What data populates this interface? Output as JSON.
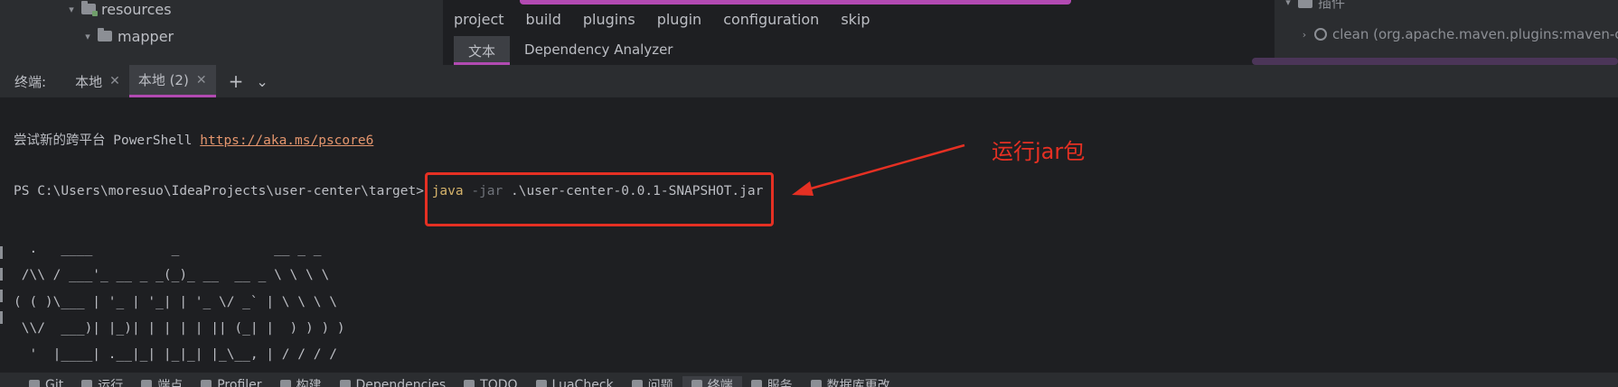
{
  "project_tree": {
    "items": [
      {
        "label": "resources",
        "expanded": true
      },
      {
        "label": "mapper",
        "expanded": true
      }
    ]
  },
  "editor": {
    "breadcrumbs": [
      "project",
      "build",
      "plugins",
      "plugin",
      "configuration",
      "skip"
    ],
    "tabs": [
      {
        "label": "文本",
        "active": true
      },
      {
        "label": "Dependency Analyzer",
        "active": false
      }
    ]
  },
  "maven": {
    "section": "插件",
    "plugin": "clean (org.apache.maven.plugins:maven-clea"
  },
  "terminal_bar": {
    "label": "终端:",
    "tabs": [
      {
        "label": "本地",
        "active": false
      },
      {
        "label": "本地 (2)",
        "active": true
      }
    ],
    "add": "+",
    "more": "⌄"
  },
  "terminal": {
    "promo_text": "尝试新的跨平台 PowerShell ",
    "promo_link": "https://aka.ms/pscore6",
    "prompt": "PS C:\\Users\\moresuo\\IdeaProjects\\user-center\\target> ",
    "cmd_java": "java",
    "cmd_flag": " -jar",
    "cmd_arg": " .\\user-center-0.0.1-SNAPSHOT.jar",
    "banner": [
      "  .   ____          _            __ _ _",
      " /\\\\ / ___'_ __ _ _(_)_ __  __ _ \\ \\ \\ \\",
      "( ( )\\___ | '_ | '_| | '_ \\/ _` | \\ \\ \\ \\",
      " \\\\/  ___)| |_)| | | | | || (_| |  ) ) ) )",
      "  '  |____| .__|_| |_|_| |_\\__, | / / / /"
    ]
  },
  "annotation": {
    "text": "运行jar包",
    "color": "#e53023"
  },
  "bottom_bar": {
    "items": [
      {
        "label": "Git",
        "icon": "git-icon"
      },
      {
        "label": "运行",
        "icon": "run-icon"
      },
      {
        "label": "端点",
        "icon": "endpoints-icon"
      },
      {
        "label": "Profiler",
        "icon": "profiler-icon"
      },
      {
        "label": "构建",
        "icon": "build-icon"
      },
      {
        "label": "Dependencies",
        "icon": "dependencies-icon"
      },
      {
        "label": "TODO",
        "icon": "todo-icon"
      },
      {
        "label": "LuaCheck",
        "icon": "luacheck-icon"
      },
      {
        "label": "问题",
        "icon": "problems-icon"
      },
      {
        "label": "终端",
        "icon": "terminal-icon",
        "active": true
      },
      {
        "label": "服务",
        "icon": "services-icon"
      },
      {
        "label": "数据库更改",
        "icon": "database-changes-icon"
      }
    ]
  },
  "colors": {
    "accent": "#b24ab2",
    "annotation_red": "#e53023",
    "keyword": "#d5b36b",
    "link": "#e5966e"
  }
}
